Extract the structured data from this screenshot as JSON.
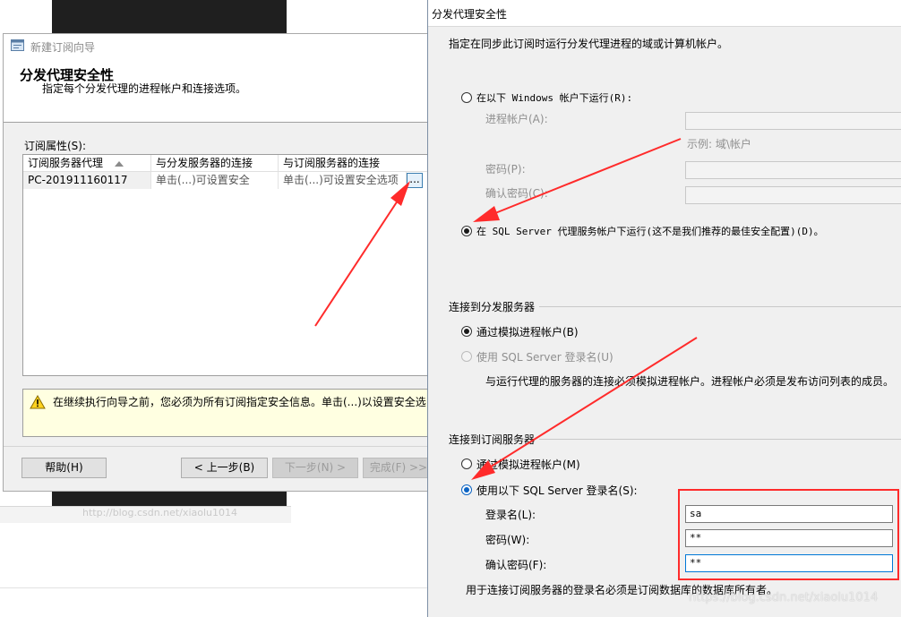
{
  "background": {
    "strip_text": "http://blog.csdn.net/xiaolu1014"
  },
  "wizard": {
    "title": "新建订阅向导",
    "heading": "分发代理安全性",
    "subheading": "指定每个分发代理的进程帐户和连接选项。",
    "grid_label": "订阅属性(S):",
    "columns": [
      "订阅服务器代理",
      "与分发服务器的连接",
      "与订阅服务器的连接"
    ],
    "row": {
      "agent": "PC-201911160117",
      "distributor_conn": "单击(...)可设置安全",
      "subscriber_conn": "单击(...)可设置安全选项",
      "ellipsis": "..."
    },
    "warning": "在继续执行向导之前，您必须为所有订阅指定安全信息。单击(...)以设置安全选",
    "buttons": {
      "help": "帮助(H)",
      "back": "< 上一步(B)",
      "next": "下一步(N) >",
      "finish": "完成(F) >>"
    }
  },
  "dialog": {
    "title": "分发代理安全性",
    "description": "指定在同步此订阅时运行分发代理进程的域或计算机帐户。",
    "run_as_windows": "在以下 Windows 帐户下运行(R):",
    "process_account_label": "进程帐户(A):",
    "example": "示例: 域\\帐户",
    "password_label": "密码(P):",
    "confirm_password_label": "确认密码(C):",
    "run_as_sql_agent": "在 SQL Server 代理服务帐户下运行(这不是我们推荐的最佳安全配置)(D)。",
    "distributor_group": "连接到分发服务器",
    "dist_impersonate": "通过模拟进程帐户(B)",
    "dist_sql_login": "使用 SQL Server 登录名(U)",
    "dist_note": "与运行代理的服务器的连接必须模拟进程帐户。进程帐户必须是发布访问列表的成员。",
    "subscriber_group": "连接到订阅服务器",
    "sub_impersonate": "通过模拟进程帐户(M)",
    "sub_sql_login": "使用以下 SQL Server 登录名(S):",
    "login_label": "登录名(L):",
    "login_value": "sa",
    "sub_password_label": "密码(W):",
    "sub_password_value": "**",
    "sub_confirm_label": "确认密码(F):",
    "sub_confirm_value": "**",
    "sub_note": "用于连接订阅服务器的登录名必须是订阅数据库的数据库所有者。"
  },
  "watermark": "https://blog.csdn.net/xiaolu1014",
  "colors": {
    "annotation_red": "#ff2b2b",
    "radio_selected_blue": "#0b63c3",
    "warning_bg": "#ffffe1"
  }
}
